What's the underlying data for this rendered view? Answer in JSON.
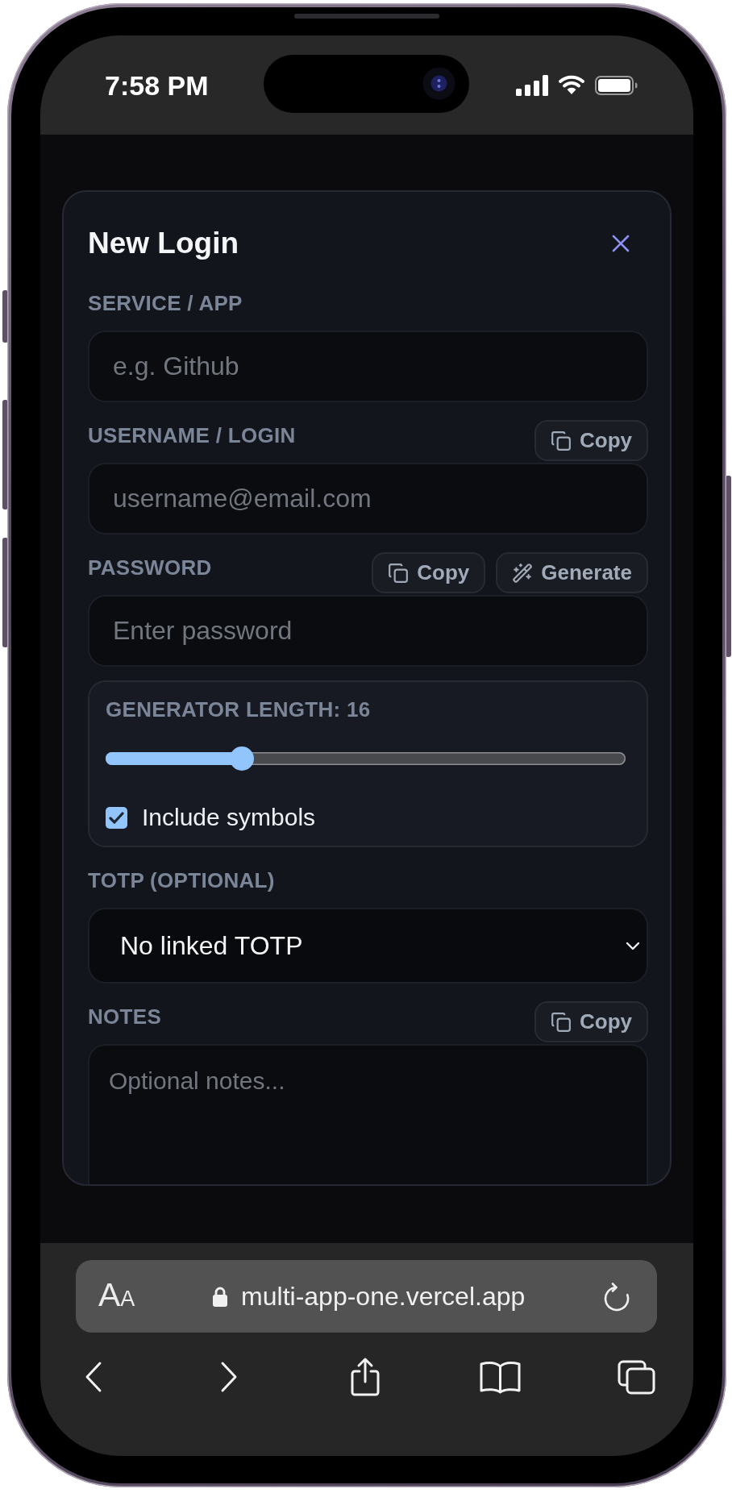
{
  "status_bar": {
    "time": "7:58 PM"
  },
  "modal": {
    "title": "New Login",
    "fields": [
      {
        "kind": "input",
        "label": "SERVICE / APP",
        "placeholder": "e.g. Github"
      },
      {
        "kind": "input",
        "label": "USERNAME / LOGIN",
        "actions": [
          {
            "kind": "copy",
            "label": "Copy"
          }
        ],
        "placeholder": "username@email.com"
      },
      {
        "kind": "input",
        "label": "PASSWORD",
        "actions": [
          {
            "kind": "copy",
            "label": "Copy"
          },
          {
            "kind": "generate",
            "label": "Generate"
          }
        ],
        "placeholder": "Enter password"
      },
      {
        "kind": "generator",
        "label": "GENERATOR LENGTH: 16",
        "level": 0.25,
        "option": {
          "label": "Include symbols",
          "checked": true
        }
      },
      {
        "kind": "select",
        "label": "TOTP (OPTIONAL)",
        "value": "No linked TOTP"
      },
      {
        "kind": "textarea",
        "label": "NOTES",
        "actions": [
          {
            "kind": "copy",
            "label": "Copy"
          }
        ],
        "placeholder": "Optional notes..."
      }
    ]
  },
  "browser": {
    "text_size": "AA",
    "url": "multi-app-one.vercel.app"
  }
}
